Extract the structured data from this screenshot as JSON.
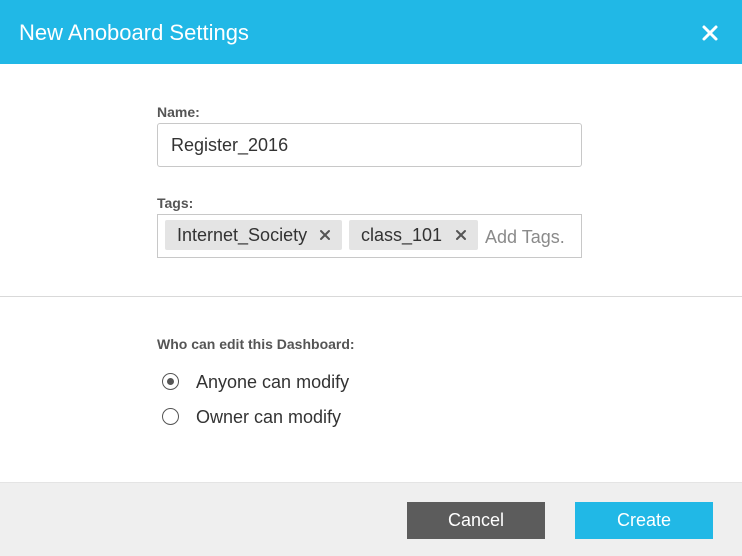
{
  "dialog": {
    "title": "New Anoboard Settings",
    "close_icon": "close-icon",
    "header_color": "#21b8e6"
  },
  "name_field": {
    "label": "Name:",
    "value": "Register_2016"
  },
  "tags_field": {
    "label": "Tags:",
    "tags": [
      {
        "label": "Internet_Society",
        "remove_icon": "remove-tag-icon"
      },
      {
        "label": "class_101",
        "remove_icon": "remove-tag-icon"
      }
    ],
    "placeholder": "Add Tags."
  },
  "permissions": {
    "label": "Who can edit this Dashboard:",
    "options": [
      {
        "label": "Anyone can modify",
        "selected": true
      },
      {
        "label": "Owner can modify",
        "selected": false
      }
    ]
  },
  "footer": {
    "cancel_label": "Cancel",
    "create_label": "Create",
    "cancel_color": "#5c5c5c",
    "create_color": "#21b8e6"
  }
}
